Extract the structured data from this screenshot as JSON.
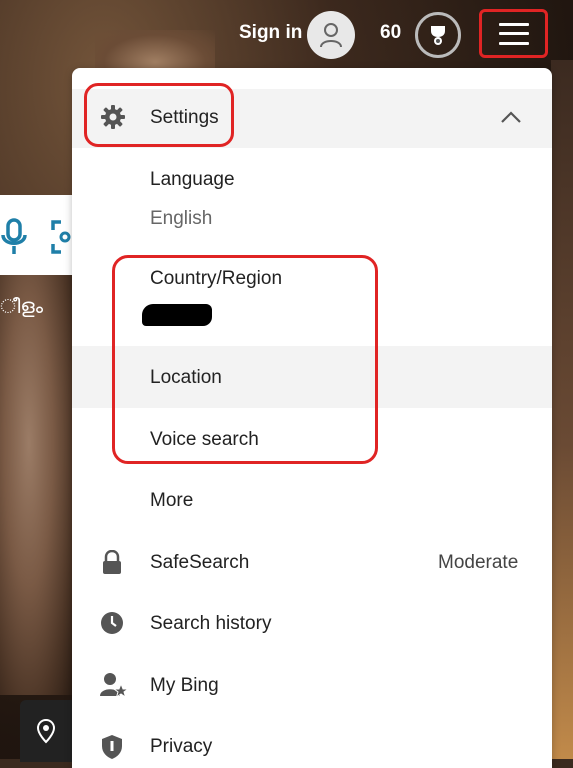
{
  "header": {
    "sign_in_label": "Sign in",
    "points": "60"
  },
  "background": {
    "side_text": "ീളം"
  },
  "menu": {
    "settings_label": "Settings",
    "language": {
      "label": "Language",
      "value": "English"
    },
    "country_region": {
      "label": "Country/Region"
    },
    "location_label": "Location",
    "voice_search_label": "Voice search",
    "more_label": "More",
    "safesearch": {
      "label": "SafeSearch",
      "value": "Moderate"
    },
    "search_history_label": "Search history",
    "my_bing_label": "My Bing",
    "privacy_label": "Privacy"
  },
  "colors": {
    "highlight": "#e02424",
    "panel_bg": "#ffffff",
    "row_hover": "#f3f3f3",
    "accent": "#1f7fa8"
  },
  "icons": [
    "user-avatar-icon",
    "rewards-trophy-icon",
    "hamburger-menu-icon",
    "gear-icon",
    "chevron-up-icon",
    "lock-icon",
    "clock-icon",
    "person-star-icon",
    "shield-icon",
    "microphone-icon",
    "visual-search-icon",
    "location-pin-icon"
  ]
}
